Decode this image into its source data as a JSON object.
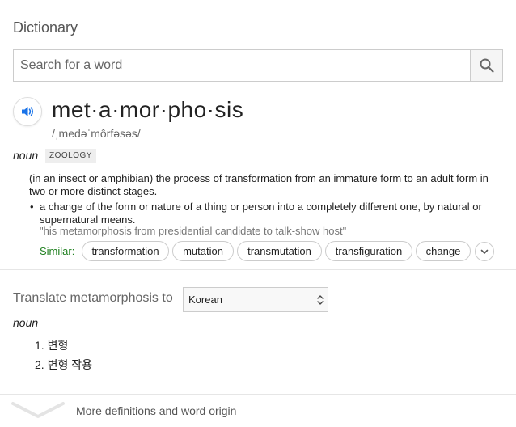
{
  "card": {
    "title": "Dictionary"
  },
  "search": {
    "placeholder": "Search for a word"
  },
  "entry": {
    "headword": "met·a·mor·pho·sis",
    "phonetic": "/ˌmedəˈmôrfəsəs/",
    "part_of_speech": "noun",
    "subject_label": "ZOOLOGY",
    "definitions": [
      "(in an insect or amphibian) the process of transformation from an immature form to an adult form in two or more distinct stages.",
      "a change of the form or nature of a thing or person into a completely different one, by natural or supernatural means."
    ],
    "example": "\"his metamorphosis from presidential candidate to talk-show host\"",
    "bullet": "•",
    "similar_label": "Similar:",
    "similar": [
      "transformation",
      "mutation",
      "transmutation",
      "transfiguration",
      "change"
    ]
  },
  "translate": {
    "label": "Translate metamorphosis to",
    "selected_language": "Korean",
    "part_of_speech": "noun",
    "items": [
      "1. 변형",
      "2. 변형 작용"
    ]
  },
  "footer": {
    "more_label": "More definitions and word origin"
  },
  "icons": {
    "search": "search-icon",
    "speaker": "speaker-icon",
    "chevron_down": "chevron-down-icon",
    "select_arrows": "select-arrows-icon"
  },
  "colors": {
    "accent_blue": "#1a73e8",
    "similar_green": "#208020",
    "border": "#cccccc"
  }
}
